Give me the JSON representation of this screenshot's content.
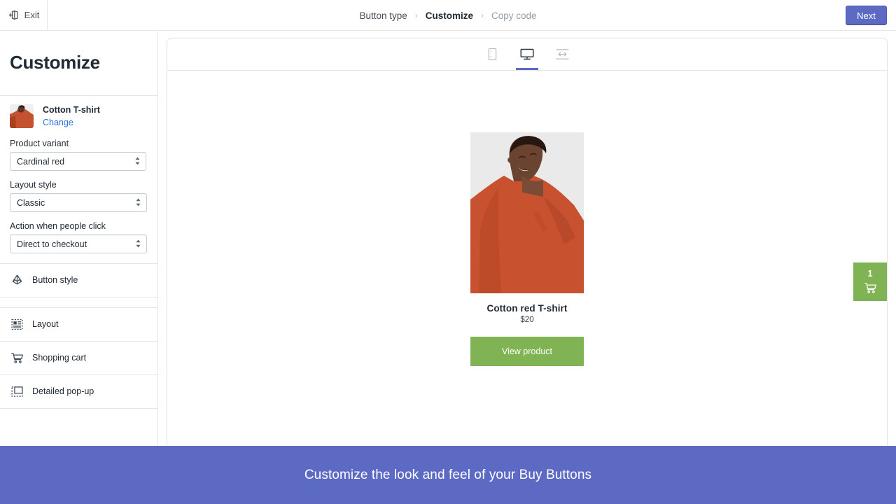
{
  "topbar": {
    "exit_label": "Exit",
    "exit_icon": "exit-arrow-icon",
    "breadcrumbs": [
      {
        "label": "Button type",
        "state": "visited"
      },
      {
        "label": "Customize",
        "state": "active"
      },
      {
        "label": "Copy code",
        "state": "upcoming"
      }
    ],
    "separator": "›",
    "next_label": "Next",
    "next_color": "#5c6ac4"
  },
  "sidebar": {
    "title": "Customize",
    "product": {
      "name": "Cotton T-shirt",
      "change_label": "Change",
      "thumbnail_icon": "product-thumbnail"
    },
    "fields": [
      {
        "label": "Product variant",
        "value": "Cardinal red"
      },
      {
        "label": "Layout style",
        "value": "Classic"
      },
      {
        "label": "Action when people click",
        "value": "Direct to checkout"
      }
    ],
    "menu": [
      {
        "label": "Button style",
        "icon": "paint-brush-icon"
      },
      {
        "label": "Layout",
        "icon": "layout-grid-icon"
      },
      {
        "label": "Shopping cart",
        "icon": "shopping-cart-icon"
      },
      {
        "label": "Detailed pop-up",
        "icon": "popup-window-icon"
      }
    ]
  },
  "preview": {
    "devices": [
      {
        "name": "mobile",
        "icon": "mobile-icon",
        "active": false
      },
      {
        "name": "desktop",
        "icon": "desktop-icon",
        "active": true
      },
      {
        "name": "full-width",
        "icon": "full-width-icon",
        "active": false
      }
    ],
    "active_indicator_color": "#5c6ac4",
    "product": {
      "title": "Cotton red T-shirt",
      "price": "$20",
      "button_label": "View product",
      "button_color": "#80b354",
      "image_alt": "Person wearing a cardinal red cotton t-shirt"
    },
    "cart": {
      "count": "1",
      "icon": "shopping-cart-icon",
      "color": "#80b354"
    }
  },
  "banner": {
    "text": "Customize the look and feel of your Buy Buttons",
    "color": "#5c6ac4"
  }
}
